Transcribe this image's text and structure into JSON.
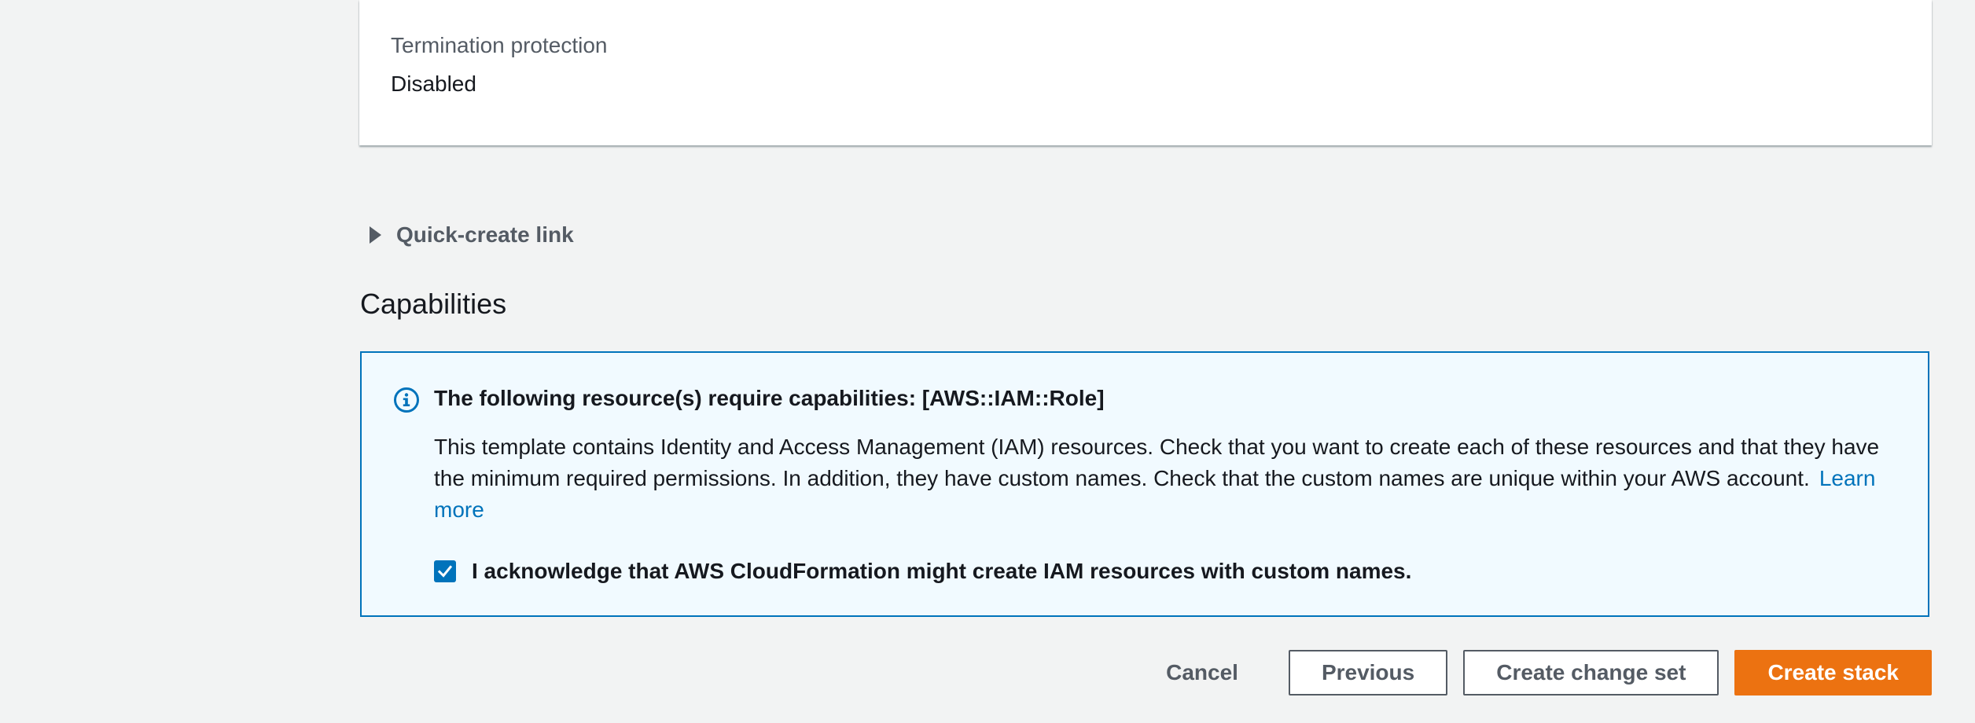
{
  "stack_details": {
    "termination_protection_label": "Termination protection",
    "termination_protection_value": "Disabled"
  },
  "quick_create": {
    "label": "Quick-create link",
    "expanded": false
  },
  "capabilities": {
    "section_title": "Capabilities",
    "alert": {
      "title": "The following resource(s) require capabilities: [AWS::IAM::Role]",
      "body": "This template contains Identity and Access Management (IAM) resources. Check that you want to create each of these resources and that they have the minimum required permissions. In addition, they have custom names. Check that the custom names are unique within your AWS account.",
      "learn_more": "Learn more",
      "icon": "info-icon"
    },
    "acknowledge": {
      "label": "I acknowledge that AWS CloudFormation might create IAM resources with custom names.",
      "checked": true
    }
  },
  "actions": {
    "cancel": "Cancel",
    "previous": "Previous",
    "create_change_set": "Create change set",
    "create_stack": "Create stack"
  },
  "colors": {
    "accent": "#0073bb",
    "primary_button": "#ec7211",
    "alert_background": "#f1faff",
    "page_background": "#f2f3f3"
  }
}
